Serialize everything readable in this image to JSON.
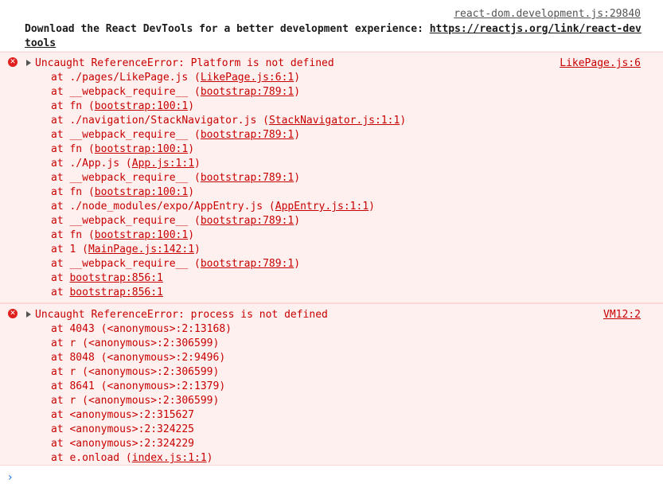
{
  "info": {
    "source": "react-dom.development.js:29840",
    "text": "Download the React DevTools for a better development experience: ",
    "url": "https://reactjs.org/link/react-devtools"
  },
  "errors": [
    {
      "message": "Uncaught ReferenceError: Platform is not defined",
      "source": "LikePage.js:6",
      "frames": [
        {
          "text": "at ./pages/LikePage.js (",
          "link": "LikePage.js:6:1",
          "end": ")"
        },
        {
          "text": "at __webpack_require__ (",
          "link": "bootstrap:789:1",
          "end": ")"
        },
        {
          "text": "at fn (",
          "link": "bootstrap:100:1",
          "end": ")"
        },
        {
          "text": "at ./navigation/StackNavigator.js (",
          "link": "StackNavigator.js:1:1",
          "end": ")"
        },
        {
          "text": "at __webpack_require__ (",
          "link": "bootstrap:789:1",
          "end": ")"
        },
        {
          "text": "at fn (",
          "link": "bootstrap:100:1",
          "end": ")"
        },
        {
          "text": "at ./App.js (",
          "link": "App.js:1:1",
          "end": ")"
        },
        {
          "text": "at __webpack_require__ (",
          "link": "bootstrap:789:1",
          "end": ")"
        },
        {
          "text": "at fn (",
          "link": "bootstrap:100:1",
          "end": ")"
        },
        {
          "text": "at ./node_modules/expo/AppEntry.js (",
          "link": "AppEntry.js:1:1",
          "end": ")"
        },
        {
          "text": "at __webpack_require__ (",
          "link": "bootstrap:789:1",
          "end": ")"
        },
        {
          "text": "at fn (",
          "link": "bootstrap:100:1",
          "end": ")"
        },
        {
          "text": "at 1 (",
          "link": "MainPage.js:142:1",
          "end": ")"
        },
        {
          "text": "at __webpack_require__ (",
          "link": "bootstrap:789:1",
          "end": ")"
        },
        {
          "text": "at ",
          "link": "bootstrap:856:1",
          "end": ""
        },
        {
          "text": "at ",
          "link": "bootstrap:856:1",
          "end": ""
        }
      ]
    },
    {
      "message": "Uncaught ReferenceError: process is not defined",
      "source": "VM12:2",
      "frames": [
        {
          "text": "at 4043 (<anonymous>:2:13168)",
          "link": "",
          "end": ""
        },
        {
          "text": "at r (<anonymous>:2:306599)",
          "link": "",
          "end": ""
        },
        {
          "text": "at 8048 (<anonymous>:2:9496)",
          "link": "",
          "end": ""
        },
        {
          "text": "at r (<anonymous>:2:306599)",
          "link": "",
          "end": ""
        },
        {
          "text": "at 8641 (<anonymous>:2:1379)",
          "link": "",
          "end": ""
        },
        {
          "text": "at r (<anonymous>:2:306599)",
          "link": "",
          "end": ""
        },
        {
          "text": "at <anonymous>:2:315627",
          "link": "",
          "end": ""
        },
        {
          "text": "at <anonymous>:2:324225",
          "link": "",
          "end": ""
        },
        {
          "text": "at <anonymous>:2:324229",
          "link": "",
          "end": ""
        },
        {
          "text": "at e.onload (",
          "link": "index.js:1:1",
          "end": ")"
        }
      ]
    }
  ],
  "icons": {
    "error": "error-circle-icon",
    "expand": "expand-triangle-icon",
    "prompt": "prompt-chevron-icon"
  },
  "colors": {
    "error_text": "#c80000",
    "error_bg": "#fff0f0",
    "error_icon": "#e0201f",
    "prompt": "#1a73e8"
  },
  "prompt": {
    "symbol": "›",
    "value": ""
  }
}
